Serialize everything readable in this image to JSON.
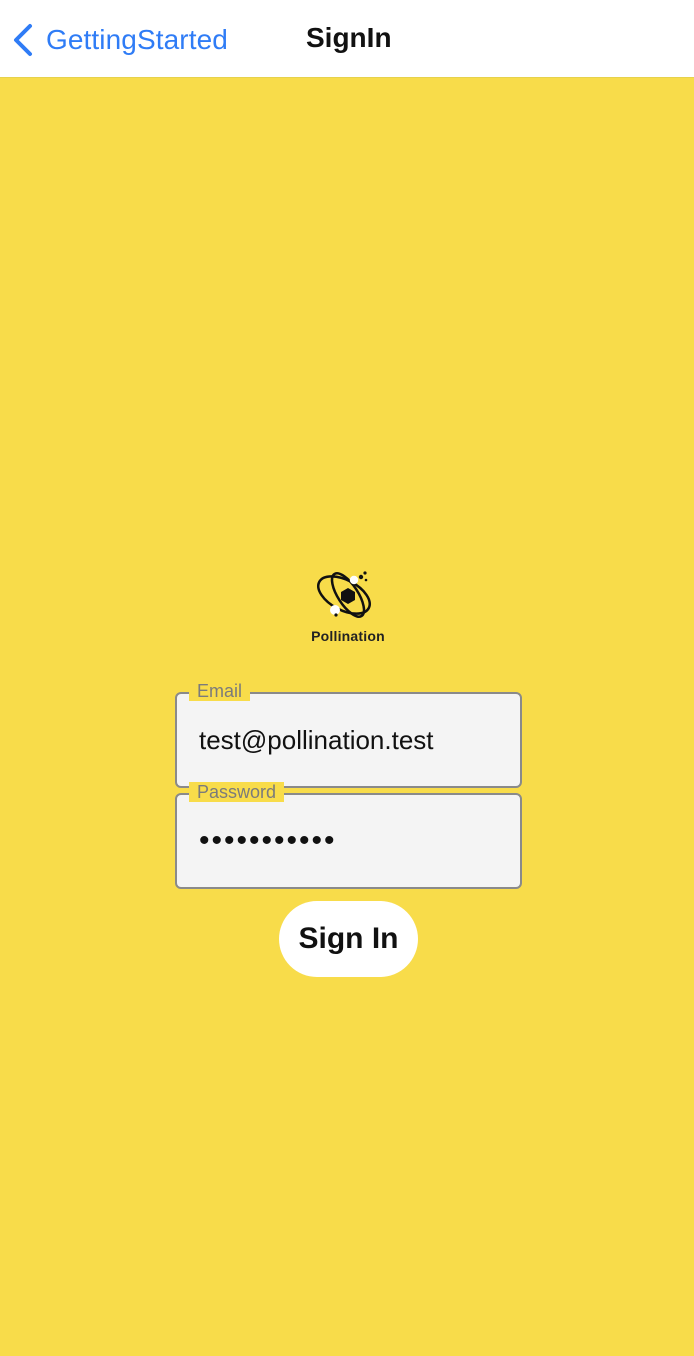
{
  "navigation": {
    "back_label": "GettingStarted",
    "title": "SignIn",
    "back_icon": "chevron-left-icon"
  },
  "brand": {
    "logo_text": "Pollination",
    "logo_icon": "bee-logo-icon"
  },
  "form": {
    "email": {
      "label": "Email",
      "value": "test@pollination.test"
    },
    "password": {
      "label": "Password",
      "masked_value": "•••••••••••"
    },
    "submit_label": "Sign In"
  },
  "colors": {
    "background": "#f8dc4a",
    "nav_background": "#ffffff",
    "link": "#2f7cf6",
    "field_background": "#f4f4f4",
    "field_border": "#8a8a8a",
    "button_background": "#ffffff"
  }
}
